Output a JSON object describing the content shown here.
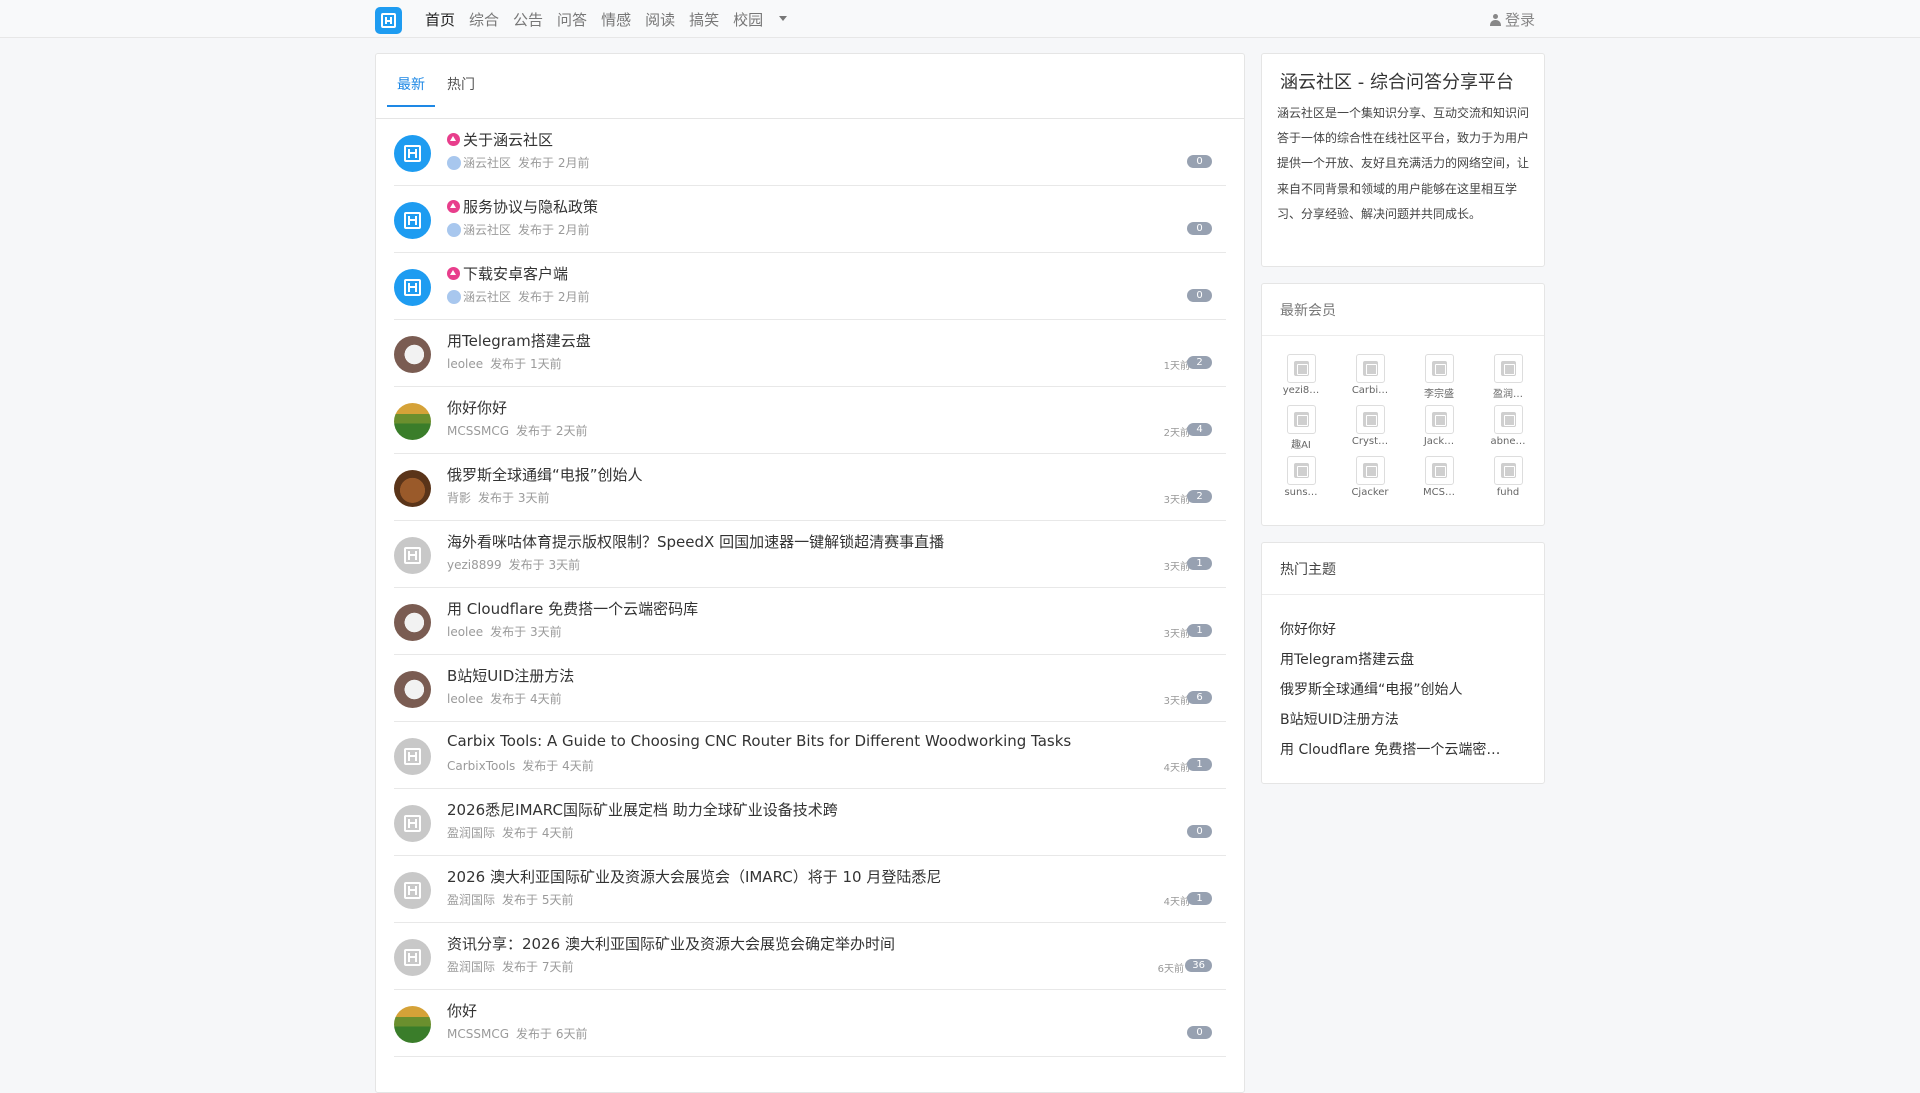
{
  "nav": {
    "items": [
      "首页",
      "综合",
      "公告",
      "问答",
      "情感",
      "阅读",
      "搞笑",
      "校园"
    ],
    "login": "登录"
  },
  "tabs": [
    "最新",
    "热门"
  ],
  "topics": [
    {
      "title": "关于涵云社区",
      "author": "涵云社区",
      "posted": "发布于 2月前",
      "time": "",
      "count": "0",
      "pinned": true,
      "avatar": "logo"
    },
    {
      "title": "服务协议与隐私政策",
      "author": "涵云社区",
      "posted": "发布于 2月前",
      "time": "",
      "count": "0",
      "pinned": true,
      "avatar": "logo"
    },
    {
      "title": "下载安卓客户端",
      "author": "涵云社区",
      "posted": "发布于 2月前",
      "time": "",
      "count": "0",
      "pinned": true,
      "avatar": "logo"
    },
    {
      "title": "用Telegram搭建云盘",
      "author": "leolee",
      "posted": "发布于 1天前",
      "time": "1天前",
      "count": "2",
      "pinned": false,
      "avatar": "cat"
    },
    {
      "title": "你好你好",
      "author": "MCSSMCG",
      "posted": "发布于 2天前",
      "time": "2天前",
      "count": "4",
      "pinned": false,
      "avatar": "mc"
    },
    {
      "title": "俄罗斯全球通缉“电报”创始人",
      "author": "背影",
      "posted": "发布于 3天前",
      "time": "3天前",
      "count": "2",
      "pinned": false,
      "avatar": "dog"
    },
    {
      "title": "海外看咪咕体育提示版权限制？SpeedX 回国加速器一键解锁超清赛事直播",
      "author": "yezi8899",
      "posted": "发布于 3天前",
      "time": "3天前",
      "count": "1",
      "pinned": false,
      "avatar": "default"
    },
    {
      "title": "用 Cloudflare 免费搭一个云端密码库",
      "author": "leolee",
      "posted": "发布于 3天前",
      "time": "3天前",
      "count": "1",
      "pinned": false,
      "avatar": "cat"
    },
    {
      "title": "B站短UID注册方法",
      "author": "leolee",
      "posted": "发布于 4天前",
      "time": "3天前",
      "count": "6",
      "pinned": false,
      "avatar": "cat"
    },
    {
      "title": "Carbix Tools: A Guide to Choosing CNC Router Bits for Different Woodworking Tasks",
      "author": "CarbixTools",
      "posted": "发布于 4天前",
      "time": "4天前",
      "count": "1",
      "pinned": false,
      "avatar": "default"
    },
    {
      "title": "2026悉尼IMARC国际矿业展定档 助力全球矿业设备技术跨",
      "author": "盈润国际",
      "posted": "发布于 4天前",
      "time": "",
      "count": "0",
      "pinned": false,
      "avatar": "default"
    },
    {
      "title": "2026 澳大利亚国际矿业及资源大会展览会（IMARC）将于 10 月登陆悉尼",
      "author": "盈润国际",
      "posted": "发布于 5天前",
      "time": "4天前",
      "count": "1",
      "pinned": false,
      "avatar": "default"
    },
    {
      "title": "资讯分享：2026 澳大利亚国际矿业及资源大会展览会确定举办时间",
      "author": "盈润国际",
      "posted": "发布于 7天前",
      "time": "6天前",
      "count": "36",
      "pinned": false,
      "avatar": "default"
    },
    {
      "title": "你好",
      "author": "MCSSMCG",
      "posted": "发布于 6天前",
      "time": "",
      "count": "0",
      "pinned": false,
      "avatar": "mc"
    }
  ],
  "about": {
    "title": "涵云社区 - 综合问答分享平台",
    "text": "涵云社区是一个集知识分享、互动交流和知识问答于一体的综合性在线社区平台，致力于为用户提供一个开放、友好且充满活力的网络空间，让来自不同背景和领域的用户能够在这里相互学习、分享经验、解决问题并共同成长。"
  },
  "members": {
    "title": "最新会员",
    "names": [
      "yezi8…",
      "Carbi…",
      "李宗盛",
      "盈润…",
      "趣AI",
      "Cryst…",
      "Jack…",
      "abne…",
      "suns…",
      "Cjacker",
      "MCS…",
      "fuhd"
    ]
  },
  "hot": {
    "title": "热门主题",
    "items": [
      "你好你好",
      "用Telegram搭建云盘",
      "俄罗斯全球通缉“电报”创始人",
      "B站短UID注册方法",
      "用 Cloudflare 免费搭一个云端密…"
    ]
  },
  "colors": {
    "accent": "#1e88e5",
    "pin": "#e83e8c",
    "badge": "#97a1b1"
  }
}
